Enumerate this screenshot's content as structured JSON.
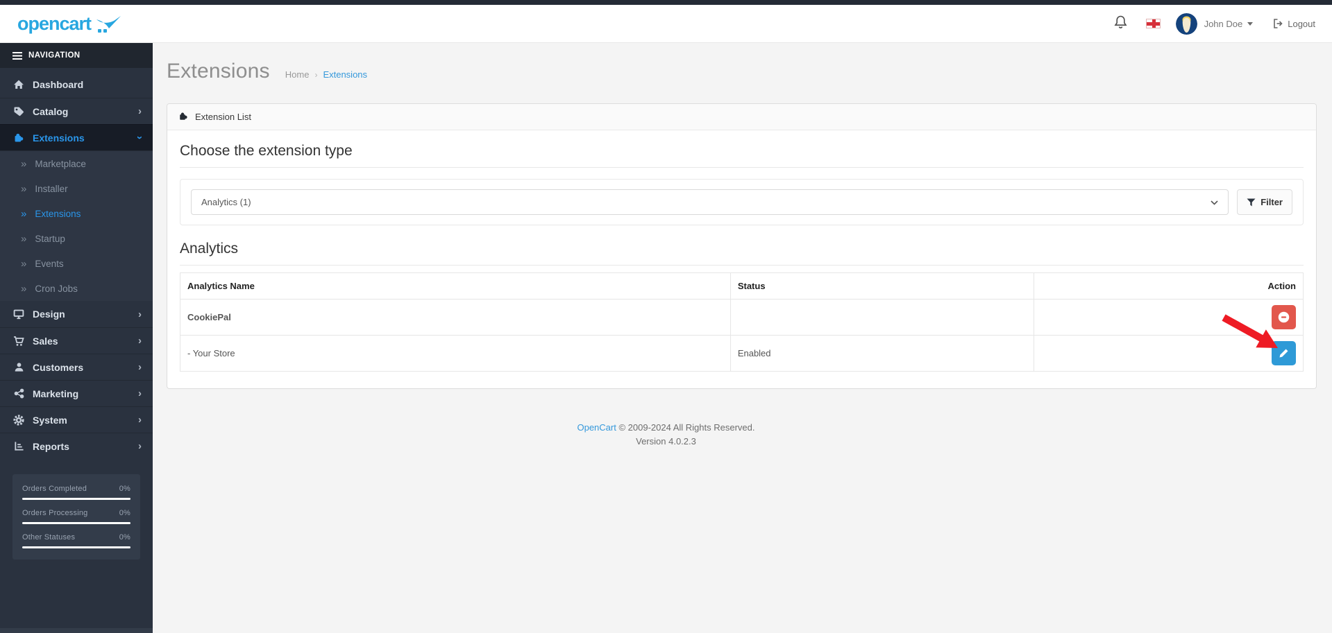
{
  "header": {
    "logo_text": "opencart",
    "user_name": "John Doe",
    "logout_label": "Logout"
  },
  "sidebar": {
    "nav_label": "NAVIGATION",
    "items": [
      {
        "label": "Dashboard",
        "icon": "home-icon",
        "has_children": false
      },
      {
        "label": "Catalog",
        "icon": "tag-icon",
        "has_children": true
      },
      {
        "label": "Extensions",
        "icon": "puzzle-icon",
        "has_children": true,
        "active": true,
        "expanded": true
      },
      {
        "label": "Design",
        "icon": "monitor-icon",
        "has_children": true
      },
      {
        "label": "Sales",
        "icon": "cart-icon",
        "has_children": true
      },
      {
        "label": "Customers",
        "icon": "user-icon",
        "has_children": true
      },
      {
        "label": "Marketing",
        "icon": "share-icon",
        "has_children": true
      },
      {
        "label": "System",
        "icon": "gear-icon",
        "has_children": true
      },
      {
        "label": "Reports",
        "icon": "chart-icon",
        "has_children": true
      }
    ],
    "submenu": [
      {
        "label": "Marketplace"
      },
      {
        "label": "Installer"
      },
      {
        "label": "Extensions",
        "active": true
      },
      {
        "label": "Startup"
      },
      {
        "label": "Events"
      },
      {
        "label": "Cron Jobs"
      }
    ],
    "stats": [
      {
        "label": "Orders Completed",
        "value": "0%"
      },
      {
        "label": "Orders Processing",
        "value": "0%"
      },
      {
        "label": "Other Statuses",
        "value": "0%"
      }
    ]
  },
  "page": {
    "title": "Extensions",
    "breadcrumb_home": "Home",
    "breadcrumb_current": "Extensions"
  },
  "card": {
    "header_title": "Extension List",
    "choose_heading": "Choose the extension type",
    "select_value": "Analytics (1)",
    "filter_label": "Filter",
    "section_heading": "Analytics",
    "table": {
      "col_name": "Analytics Name",
      "col_status": "Status",
      "col_action": "Action",
      "rows": [
        {
          "name": "CookiePal",
          "status": "",
          "action": "disable"
        },
        {
          "name": "- Your Store",
          "status": "Enabled",
          "action": "edit"
        }
      ]
    }
  },
  "footer": {
    "link_text": "OpenCart",
    "copyright_text": " © 2009-2024 All Rights Reserved.",
    "version_text": "Version 4.0.2.3"
  },
  "colors": {
    "accent_blue": "#2e9ad7",
    "sidebar_active_blue": "#2a96ea",
    "danger_red": "#e2574c",
    "logo_blue": "#28a7e0",
    "arrow_red": "#ee1b24",
    "sidebar_bg": "#2a323f"
  }
}
